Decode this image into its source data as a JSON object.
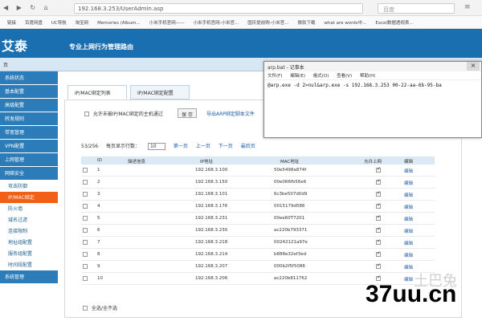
{
  "browser": {
    "url": "192.168.3.253/UserAdmin.asp",
    "search_placeholder": "百度"
  },
  "bookmarks": [
    "链接",
    "百度网盘",
    "UC导航",
    "淘宝网",
    "Memories (Album...",
    "小米手机官网——",
    "小米手机官网-小米官...",
    "国庆提前购-小米官...",
    "微软下载",
    "what are words中...",
    "Excel数据透视表..."
  ],
  "header": {
    "logo": "艾泰",
    "slogan": "专业上网行为管理路由"
  },
  "breadcrumb": "页",
  "sidebar": {
    "items": [
      "系统状态",
      "基本配置",
      "高级配置",
      "转发规则",
      "带宽管理",
      "VPN配置",
      "上网管理",
      "网络安全"
    ],
    "subitems": [
      "攻击防御",
      "IP/MAC绑定",
      "防火墙",
      "域名过滤",
      "连接限制",
      "地址组配置",
      "服务组配置",
      "时间段配置"
    ],
    "footer": "系统管理"
  },
  "tabs": [
    "IP/MAC绑定列表",
    "IP/MAC绑定配置"
  ],
  "controls": {
    "allow_label": "允许未被IP/MAC绑定的主机通过",
    "save_label": "保 存",
    "export_label": "导出ARP绑定脚本文件",
    "count": "53/256",
    "perpage_label": "每页显示行数：",
    "perpage_value": "10",
    "first": "第一页",
    "prev": "上一页",
    "next": "下一页",
    "last": "最后页"
  },
  "table": {
    "headers": [
      "ID",
      "描述信息",
      "IP地址",
      "MAC地址",
      "允许上网",
      "编辑"
    ],
    "rows": [
      {
        "id": "1",
        "ip": "192.168.3.100",
        "mac": "50e5498a874f",
        "edit": "编辑"
      },
      {
        "id": "2",
        "ip": "192.168.3.150",
        "mac": "00e066fb56e6",
        "edit": "编辑"
      },
      {
        "id": "3",
        "ip": "192.168.3.101",
        "mac": "6c3be507d0d9",
        "edit": "编辑"
      },
      {
        "id": "4",
        "ip": "192.168.3.176",
        "mac": "0015179d586",
        "edit": "编辑"
      },
      {
        "id": "5",
        "ip": "192.168.3.231",
        "mac": "00ee60T7201",
        "edit": "编辑"
      },
      {
        "id": "6",
        "ip": "192.168.3.230",
        "mac": "ac220b793371",
        "edit": "编辑"
      },
      {
        "id": "7",
        "ip": "192.168.3.218",
        "mac": "00242121a97e",
        "edit": "编辑"
      },
      {
        "id": "8",
        "ip": "192.168.3.214",
        "mac": "b888e32ef3ed",
        "edit": "编辑"
      },
      {
        "id": "9",
        "ip": "192.168.3.207",
        "mac": "000b2f5f5086",
        "edit": "编辑"
      },
      {
        "id": "10",
        "ip": "192.168.3.206",
        "mac": "ac220b811762",
        "edit": "编辑"
      }
    ],
    "select_all": "全选/全不选"
  },
  "notepad": {
    "title": "arp.bat - 记事本",
    "menu": [
      "文件(F)",
      "编辑(E)",
      "格式(O)",
      "查看(V)",
      "帮助(H)"
    ],
    "content": "@arp.exe -d 2>nul&arp.exe -s 192.168.3.253 00-22-aa-6b-95-ba"
  },
  "watermark": "37uu.cn",
  "watermark_faint": "土巴兔"
}
